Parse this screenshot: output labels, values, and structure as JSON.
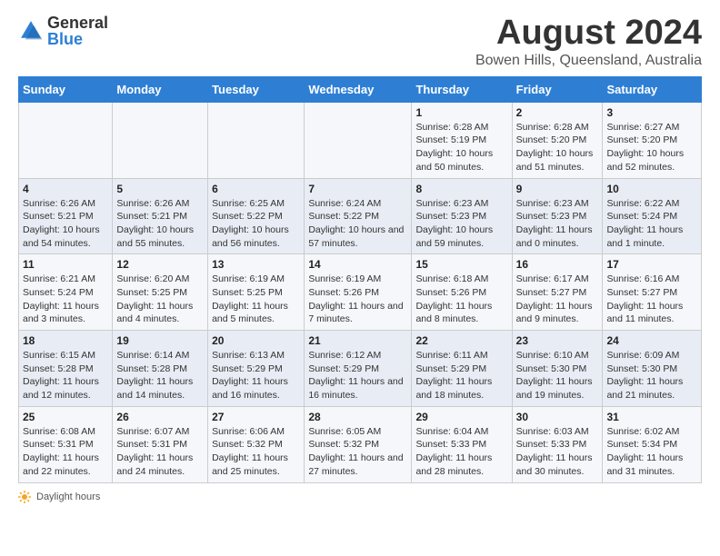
{
  "logo": {
    "general": "General",
    "blue": "Blue"
  },
  "title": "August 2024",
  "subtitle": "Bowen Hills, Queensland, Australia",
  "days_of_week": [
    "Sunday",
    "Monday",
    "Tuesday",
    "Wednesday",
    "Thursday",
    "Friday",
    "Saturday"
  ],
  "weeks": [
    [
      {
        "day": "",
        "info": ""
      },
      {
        "day": "",
        "info": ""
      },
      {
        "day": "",
        "info": ""
      },
      {
        "day": "",
        "info": ""
      },
      {
        "day": "1",
        "info": "Sunrise: 6:28 AM\nSunset: 5:19 PM\nDaylight: 10 hours and 50 minutes."
      },
      {
        "day": "2",
        "info": "Sunrise: 6:28 AM\nSunset: 5:20 PM\nDaylight: 10 hours and 51 minutes."
      },
      {
        "day": "3",
        "info": "Sunrise: 6:27 AM\nSunset: 5:20 PM\nDaylight: 10 hours and 52 minutes."
      }
    ],
    [
      {
        "day": "4",
        "info": "Sunrise: 6:26 AM\nSunset: 5:21 PM\nDaylight: 10 hours and 54 minutes."
      },
      {
        "day": "5",
        "info": "Sunrise: 6:26 AM\nSunset: 5:21 PM\nDaylight: 10 hours and 55 minutes."
      },
      {
        "day": "6",
        "info": "Sunrise: 6:25 AM\nSunset: 5:22 PM\nDaylight: 10 hours and 56 minutes."
      },
      {
        "day": "7",
        "info": "Sunrise: 6:24 AM\nSunset: 5:22 PM\nDaylight: 10 hours and 57 minutes."
      },
      {
        "day": "8",
        "info": "Sunrise: 6:23 AM\nSunset: 5:23 PM\nDaylight: 10 hours and 59 minutes."
      },
      {
        "day": "9",
        "info": "Sunrise: 6:23 AM\nSunset: 5:23 PM\nDaylight: 11 hours and 0 minutes."
      },
      {
        "day": "10",
        "info": "Sunrise: 6:22 AM\nSunset: 5:24 PM\nDaylight: 11 hours and 1 minute."
      }
    ],
    [
      {
        "day": "11",
        "info": "Sunrise: 6:21 AM\nSunset: 5:24 PM\nDaylight: 11 hours and 3 minutes."
      },
      {
        "day": "12",
        "info": "Sunrise: 6:20 AM\nSunset: 5:25 PM\nDaylight: 11 hours and 4 minutes."
      },
      {
        "day": "13",
        "info": "Sunrise: 6:19 AM\nSunset: 5:25 PM\nDaylight: 11 hours and 5 minutes."
      },
      {
        "day": "14",
        "info": "Sunrise: 6:19 AM\nSunset: 5:26 PM\nDaylight: 11 hours and 7 minutes."
      },
      {
        "day": "15",
        "info": "Sunrise: 6:18 AM\nSunset: 5:26 PM\nDaylight: 11 hours and 8 minutes."
      },
      {
        "day": "16",
        "info": "Sunrise: 6:17 AM\nSunset: 5:27 PM\nDaylight: 11 hours and 9 minutes."
      },
      {
        "day": "17",
        "info": "Sunrise: 6:16 AM\nSunset: 5:27 PM\nDaylight: 11 hours and 11 minutes."
      }
    ],
    [
      {
        "day": "18",
        "info": "Sunrise: 6:15 AM\nSunset: 5:28 PM\nDaylight: 11 hours and 12 minutes."
      },
      {
        "day": "19",
        "info": "Sunrise: 6:14 AM\nSunset: 5:28 PM\nDaylight: 11 hours and 14 minutes."
      },
      {
        "day": "20",
        "info": "Sunrise: 6:13 AM\nSunset: 5:29 PM\nDaylight: 11 hours and 16 minutes."
      },
      {
        "day": "21",
        "info": "Sunrise: 6:12 AM\nSunset: 5:29 PM\nDaylight: 11 hours and 16 minutes."
      },
      {
        "day": "22",
        "info": "Sunrise: 6:11 AM\nSunset: 5:29 PM\nDaylight: 11 hours and 18 minutes."
      },
      {
        "day": "23",
        "info": "Sunrise: 6:10 AM\nSunset: 5:30 PM\nDaylight: 11 hours and 19 minutes."
      },
      {
        "day": "24",
        "info": "Sunrise: 6:09 AM\nSunset: 5:30 PM\nDaylight: 11 hours and 21 minutes."
      }
    ],
    [
      {
        "day": "25",
        "info": "Sunrise: 6:08 AM\nSunset: 5:31 PM\nDaylight: 11 hours and 22 minutes."
      },
      {
        "day": "26",
        "info": "Sunrise: 6:07 AM\nSunset: 5:31 PM\nDaylight: 11 hours and 24 minutes."
      },
      {
        "day": "27",
        "info": "Sunrise: 6:06 AM\nSunset: 5:32 PM\nDaylight: 11 hours and 25 minutes."
      },
      {
        "day": "28",
        "info": "Sunrise: 6:05 AM\nSunset: 5:32 PM\nDaylight: 11 hours and 27 minutes."
      },
      {
        "day": "29",
        "info": "Sunrise: 6:04 AM\nSunset: 5:33 PM\nDaylight: 11 hours and 28 minutes."
      },
      {
        "day": "30",
        "info": "Sunrise: 6:03 AM\nSunset: 5:33 PM\nDaylight: 11 hours and 30 minutes."
      },
      {
        "day": "31",
        "info": "Sunrise: 6:02 AM\nSunset: 5:34 PM\nDaylight: 11 hours and 31 minutes."
      }
    ]
  ],
  "footer": {
    "daylight_label": "Daylight hours"
  },
  "colors": {
    "header_bg": "#2e7fd4",
    "header_text": "#ffffff",
    "odd_row": "#f5f7fa",
    "even_row": "#e8edf5"
  }
}
